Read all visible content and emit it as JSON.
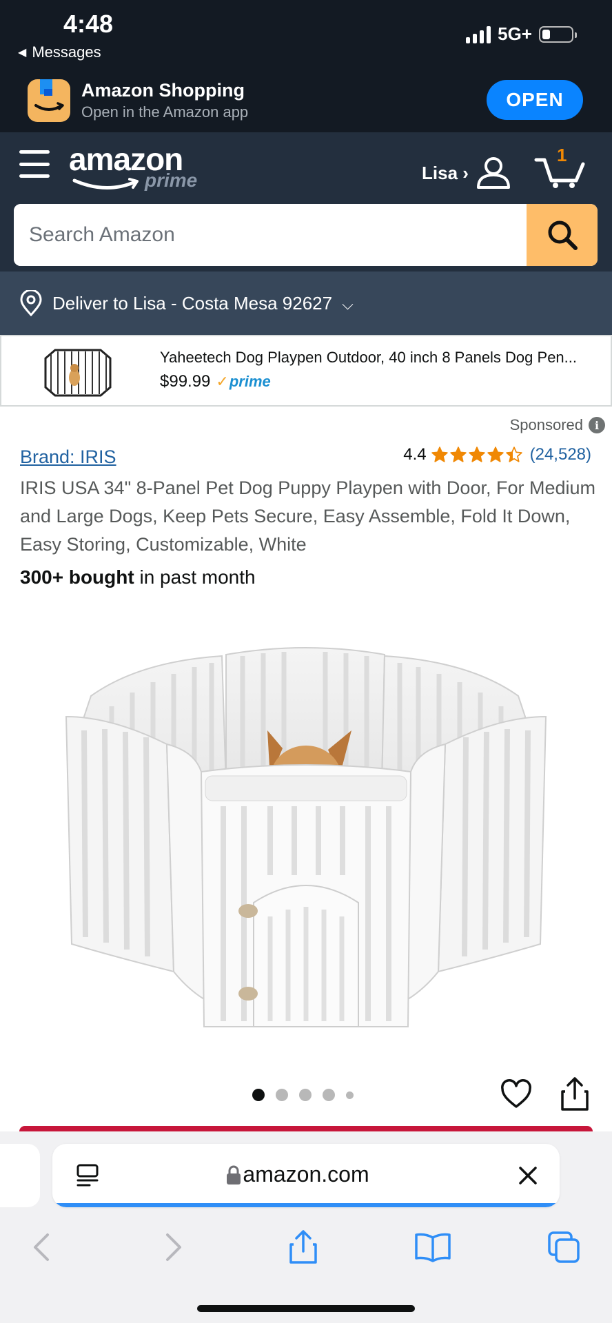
{
  "status_bar": {
    "time": "4:48",
    "back_app": "Messages",
    "network": "5G+"
  },
  "app_banner": {
    "title": "Amazon Shopping",
    "subtitle": "Open in the Amazon app",
    "open_label": "OPEN"
  },
  "header": {
    "logo_word": "amazon",
    "logo_prime": "prime",
    "account_name": "Lisa ›",
    "cart_count": "1",
    "search_placeholder": "Search Amazon"
  },
  "deliver": {
    "label": "Deliver to Lisa - Costa Mesa 92627",
    "chevron": "⌵"
  },
  "sponsored_product": {
    "title": "Yaheetech Dog Playpen Outdoor, 40 inch 8 Panels Dog Pen...",
    "price": "$99.99",
    "prime_label": "prime"
  },
  "product": {
    "sponsored_label": "Sponsored",
    "brand": "Brand: IRIS",
    "rating_score": "4.4",
    "rating_value": 4.4,
    "review_count": "(24,528)",
    "title": "IRIS USA 34\" 8-Panel Pet Dog Puppy Playpen with Door, For Medium and Large Dogs, Keep Pets Secure, Easy Assemble, Fold It Down, Easy Storing, Customizable, White",
    "bought_bold": "300+ bought",
    "bought_rest": " in past month",
    "image_count": 5,
    "active_image": 1
  },
  "safari": {
    "domain": "amazon.com"
  },
  "colors": {
    "header_bg": "#232f3e",
    "deliver_bg": "#37475a",
    "search_button": "#febd69",
    "open_button": "#0a84ff",
    "star": "#f08804",
    "link": "#2162a1",
    "safari_tint": "#2f8ef7"
  },
  "icons": [
    "hamburger-icon",
    "user-icon",
    "cart-icon",
    "search-icon",
    "location-pin-icon",
    "info-icon",
    "heart-icon",
    "share-icon",
    "reader-icon",
    "lock-icon",
    "close-icon",
    "back-icon",
    "forward-icon",
    "bookmarks-icon",
    "tabs-icon"
  ]
}
